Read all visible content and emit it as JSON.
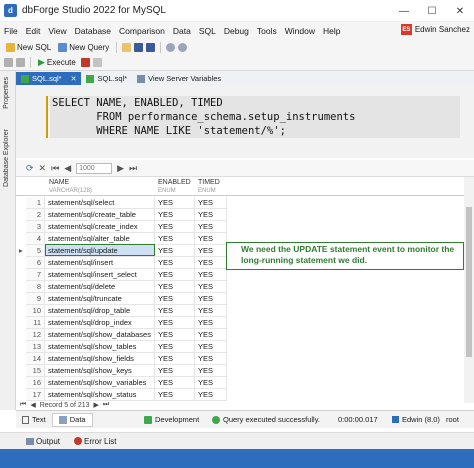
{
  "window": {
    "title": "dbForge Studio 2022 for MySQL",
    "app_icon_letter": "d",
    "controls": [
      "—",
      "☐",
      "✕"
    ]
  },
  "menu": {
    "items": [
      "File",
      "Edit",
      "View",
      "Database",
      "Comparison",
      "Data",
      "SQL",
      "Debug",
      "Tools",
      "Window",
      "Help"
    ],
    "user_initials": "ES",
    "user_name": "Edwin Sanchez"
  },
  "toolbar": {
    "new_sql": "New SQL",
    "new_query": "New Query",
    "execute": "Execute"
  },
  "tabs": [
    {
      "label": "SQL.sql*",
      "active": true
    },
    {
      "label": "SQL.sql*",
      "active": false
    },
    {
      "label": "View Server Variables",
      "active": false
    }
  ],
  "side_tabs": [
    "Properties",
    "Database Explorer"
  ],
  "editor": {
    "lines": [
      "SELECT NAME, ENABLED, TIMED",
      "       FROM performance_schema.setup_instruments",
      "       WHERE NAME LIKE 'statement/%';"
    ]
  },
  "grid_toolbar": {
    "count": "1000"
  },
  "grid": {
    "columns": [
      {
        "name": "NAME",
        "type": "VARCHAR(128)"
      },
      {
        "name": "ENABLED",
        "type": "ENUM"
      },
      {
        "name": "TIMED",
        "type": "ENUM"
      }
    ],
    "rows": [
      {
        "num": "1",
        "name": "statement/sql/select",
        "enabled": "YES",
        "timed": "YES"
      },
      {
        "num": "2",
        "name": "statement/sql/create_table",
        "enabled": "YES",
        "timed": "YES"
      },
      {
        "num": "3",
        "name": "statement/sql/create_index",
        "enabled": "YES",
        "timed": "YES"
      },
      {
        "num": "4",
        "name": "statement/sql/alter_table",
        "enabled": "YES",
        "timed": "YES"
      },
      {
        "num": "5",
        "name": "statement/sql/update",
        "enabled": "YES",
        "timed": "YES"
      },
      {
        "num": "6",
        "name": "statement/sql/insert",
        "enabled": "YES",
        "timed": "YES"
      },
      {
        "num": "7",
        "name": "statement/sql/insert_select",
        "enabled": "YES",
        "timed": "YES"
      },
      {
        "num": "8",
        "name": "statement/sql/delete",
        "enabled": "YES",
        "timed": "YES"
      },
      {
        "num": "9",
        "name": "statement/sql/truncate",
        "enabled": "YES",
        "timed": "YES"
      },
      {
        "num": "10",
        "name": "statement/sql/drop_table",
        "enabled": "YES",
        "timed": "YES"
      },
      {
        "num": "11",
        "name": "statement/sql/drop_index",
        "enabled": "YES",
        "timed": "YES"
      },
      {
        "num": "12",
        "name": "statement/sql/show_databases",
        "enabled": "YES",
        "timed": "YES"
      },
      {
        "num": "13",
        "name": "statement/sql/show_tables",
        "enabled": "YES",
        "timed": "YES"
      },
      {
        "num": "14",
        "name": "statement/sql/show_fields",
        "enabled": "YES",
        "timed": "YES"
      },
      {
        "num": "15",
        "name": "statement/sql/show_keys",
        "enabled": "YES",
        "timed": "YES"
      },
      {
        "num": "16",
        "name": "statement/sql/show_variables",
        "enabled": "YES",
        "timed": "YES"
      },
      {
        "num": "17",
        "name": "statement/sql/show_status",
        "enabled": "YES",
        "timed": "YES"
      }
    ],
    "selected_row_marker": "▸"
  },
  "annotation": {
    "text": "We need the UPDATE statement event to monitor the long-running statement we did."
  },
  "navigator": {
    "record_text": "Record 5 of 213"
  },
  "status": {
    "text_tab": "Text",
    "data_tab": "Data",
    "environment": "Development",
    "message": "Query executed successfully.",
    "elapsed": "0:00:00.017",
    "connection": "Edwin (8.0)",
    "user": "root"
  },
  "bottom_tabs": {
    "output": "Output",
    "error_list": "Error List"
  },
  "colors": {
    "accent": "#2e6dbd",
    "annotation": "#2f7d2f",
    "dev_status": "#3ea84a"
  }
}
